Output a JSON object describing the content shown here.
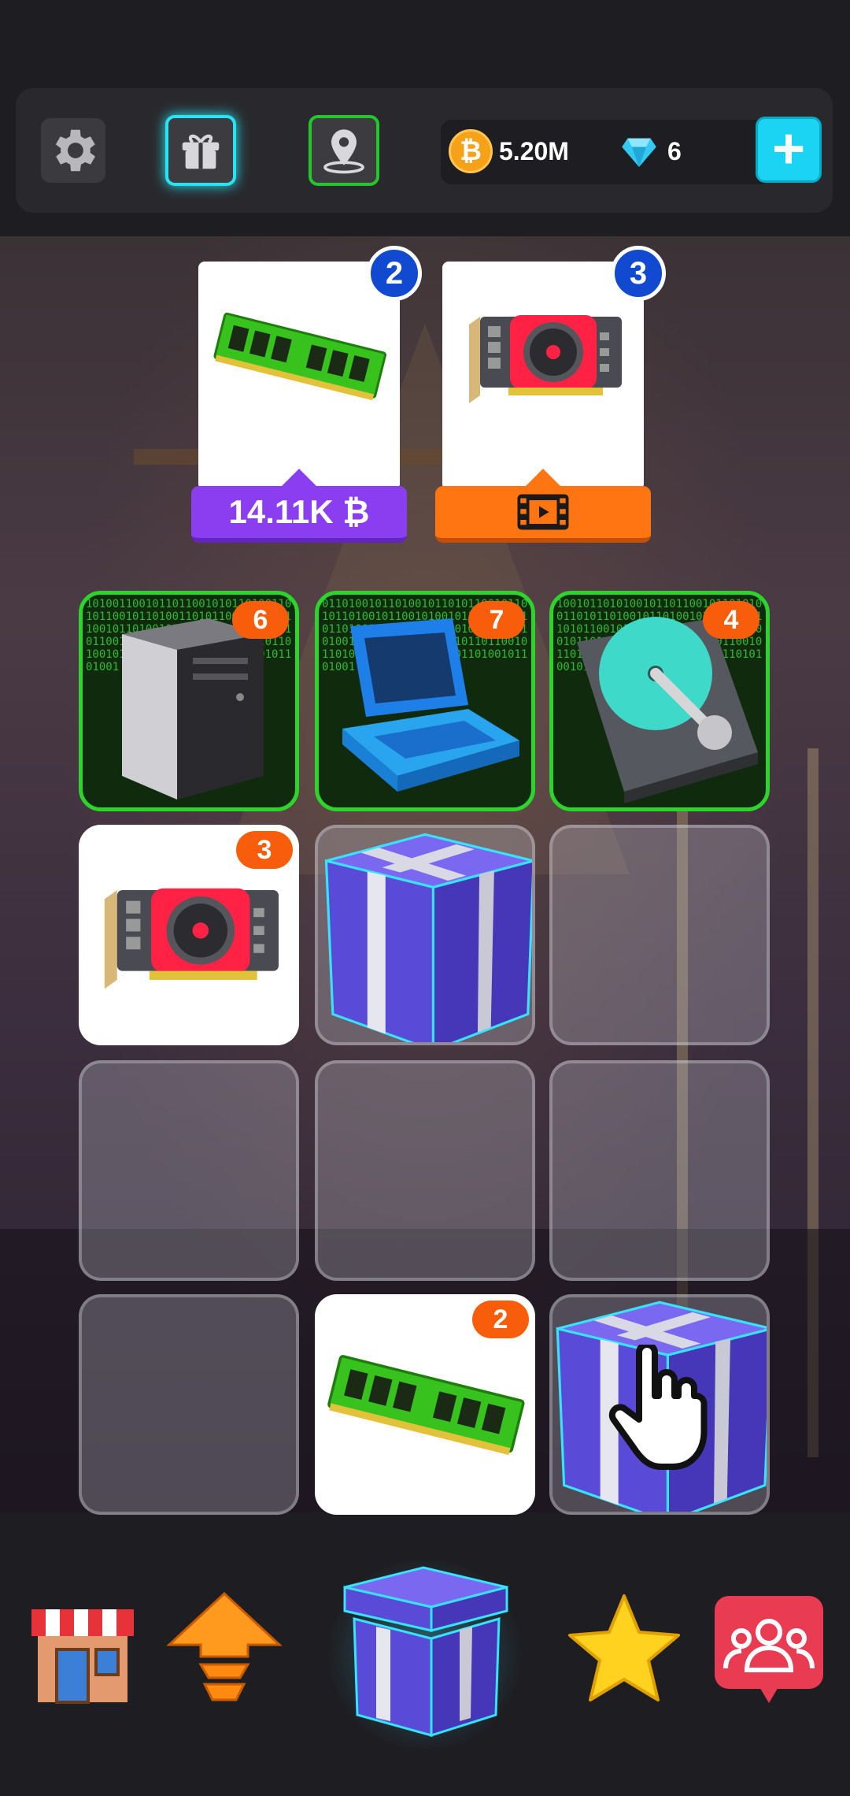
{
  "currency": {
    "coins": "5.20M",
    "gems": "6",
    "coin_symbol": "₿"
  },
  "orders": [
    {
      "item": "ram-stick",
      "required": "2",
      "reward": "14.11K ₿",
      "reward_type": "coins"
    },
    {
      "item": "graphics-card",
      "required": "3",
      "reward": "",
      "reward_type": "watch-video"
    }
  ],
  "grid": [
    {
      "item": "pc-tower",
      "count": "6",
      "style": "matrix"
    },
    {
      "item": "retro-laptop",
      "count": "7",
      "style": "matrix"
    },
    {
      "item": "hard-drive",
      "count": "4",
      "style": "matrix"
    },
    {
      "item": "graphics-card",
      "count": "3",
      "style": "white"
    },
    {
      "item": "gift-box",
      "count": "",
      "style": "empty"
    },
    {
      "item": "",
      "count": "",
      "style": "empty"
    },
    {
      "item": "",
      "count": "",
      "style": "empty"
    },
    {
      "item": "",
      "count": "",
      "style": "empty"
    },
    {
      "item": "",
      "count": "",
      "style": "empty"
    },
    {
      "item": "",
      "count": "",
      "style": "empty"
    },
    {
      "item": "ram-stick",
      "count": "2",
      "style": "white"
    },
    {
      "item": "gift-box",
      "count": "",
      "style": "empty"
    }
  ],
  "bottom_nav": [
    "shop-icon",
    "upgrade-icon",
    "gift-box-icon",
    "star-icon",
    "community-icon"
  ],
  "colors": {
    "accent_cyan": "#1bd3f2",
    "badge_orange": "#f85d0b",
    "badge_blue": "#1149d1",
    "reward_purple": "#8a3ef0",
    "reward_orange": "#ff7512",
    "gift_purple": "#5a4ad8"
  }
}
